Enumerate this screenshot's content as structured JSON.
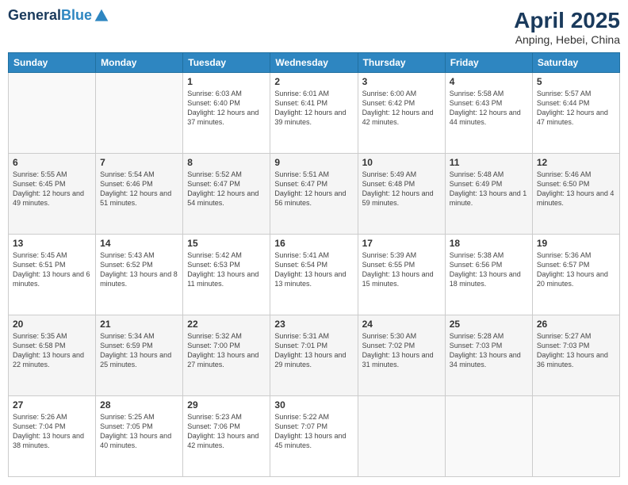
{
  "header": {
    "logo_line1": "General",
    "logo_line2": "Blue",
    "title": "April 2025",
    "subtitle": "Anping, Hebei, China"
  },
  "weekdays": [
    "Sunday",
    "Monday",
    "Tuesday",
    "Wednesday",
    "Thursday",
    "Friday",
    "Saturday"
  ],
  "weeks": [
    [
      {
        "day": "",
        "info": ""
      },
      {
        "day": "",
        "info": ""
      },
      {
        "day": "1",
        "info": "Sunrise: 6:03 AM\nSunset: 6:40 PM\nDaylight: 12 hours and 37 minutes."
      },
      {
        "day": "2",
        "info": "Sunrise: 6:01 AM\nSunset: 6:41 PM\nDaylight: 12 hours and 39 minutes."
      },
      {
        "day": "3",
        "info": "Sunrise: 6:00 AM\nSunset: 6:42 PM\nDaylight: 12 hours and 42 minutes."
      },
      {
        "day": "4",
        "info": "Sunrise: 5:58 AM\nSunset: 6:43 PM\nDaylight: 12 hours and 44 minutes."
      },
      {
        "day": "5",
        "info": "Sunrise: 5:57 AM\nSunset: 6:44 PM\nDaylight: 12 hours and 47 minutes."
      }
    ],
    [
      {
        "day": "6",
        "info": "Sunrise: 5:55 AM\nSunset: 6:45 PM\nDaylight: 12 hours and 49 minutes."
      },
      {
        "day": "7",
        "info": "Sunrise: 5:54 AM\nSunset: 6:46 PM\nDaylight: 12 hours and 51 minutes."
      },
      {
        "day": "8",
        "info": "Sunrise: 5:52 AM\nSunset: 6:47 PM\nDaylight: 12 hours and 54 minutes."
      },
      {
        "day": "9",
        "info": "Sunrise: 5:51 AM\nSunset: 6:47 PM\nDaylight: 12 hours and 56 minutes."
      },
      {
        "day": "10",
        "info": "Sunrise: 5:49 AM\nSunset: 6:48 PM\nDaylight: 12 hours and 59 minutes."
      },
      {
        "day": "11",
        "info": "Sunrise: 5:48 AM\nSunset: 6:49 PM\nDaylight: 13 hours and 1 minute."
      },
      {
        "day": "12",
        "info": "Sunrise: 5:46 AM\nSunset: 6:50 PM\nDaylight: 13 hours and 4 minutes."
      }
    ],
    [
      {
        "day": "13",
        "info": "Sunrise: 5:45 AM\nSunset: 6:51 PM\nDaylight: 13 hours and 6 minutes."
      },
      {
        "day": "14",
        "info": "Sunrise: 5:43 AM\nSunset: 6:52 PM\nDaylight: 13 hours and 8 minutes."
      },
      {
        "day": "15",
        "info": "Sunrise: 5:42 AM\nSunset: 6:53 PM\nDaylight: 13 hours and 11 minutes."
      },
      {
        "day": "16",
        "info": "Sunrise: 5:41 AM\nSunset: 6:54 PM\nDaylight: 13 hours and 13 minutes."
      },
      {
        "day": "17",
        "info": "Sunrise: 5:39 AM\nSunset: 6:55 PM\nDaylight: 13 hours and 15 minutes."
      },
      {
        "day": "18",
        "info": "Sunrise: 5:38 AM\nSunset: 6:56 PM\nDaylight: 13 hours and 18 minutes."
      },
      {
        "day": "19",
        "info": "Sunrise: 5:36 AM\nSunset: 6:57 PM\nDaylight: 13 hours and 20 minutes."
      }
    ],
    [
      {
        "day": "20",
        "info": "Sunrise: 5:35 AM\nSunset: 6:58 PM\nDaylight: 13 hours and 22 minutes."
      },
      {
        "day": "21",
        "info": "Sunrise: 5:34 AM\nSunset: 6:59 PM\nDaylight: 13 hours and 25 minutes."
      },
      {
        "day": "22",
        "info": "Sunrise: 5:32 AM\nSunset: 7:00 PM\nDaylight: 13 hours and 27 minutes."
      },
      {
        "day": "23",
        "info": "Sunrise: 5:31 AM\nSunset: 7:01 PM\nDaylight: 13 hours and 29 minutes."
      },
      {
        "day": "24",
        "info": "Sunrise: 5:30 AM\nSunset: 7:02 PM\nDaylight: 13 hours and 31 minutes."
      },
      {
        "day": "25",
        "info": "Sunrise: 5:28 AM\nSunset: 7:03 PM\nDaylight: 13 hours and 34 minutes."
      },
      {
        "day": "26",
        "info": "Sunrise: 5:27 AM\nSunset: 7:03 PM\nDaylight: 13 hours and 36 minutes."
      }
    ],
    [
      {
        "day": "27",
        "info": "Sunrise: 5:26 AM\nSunset: 7:04 PM\nDaylight: 13 hours and 38 minutes."
      },
      {
        "day": "28",
        "info": "Sunrise: 5:25 AM\nSunset: 7:05 PM\nDaylight: 13 hours and 40 minutes."
      },
      {
        "day": "29",
        "info": "Sunrise: 5:23 AM\nSunset: 7:06 PM\nDaylight: 13 hours and 42 minutes."
      },
      {
        "day": "30",
        "info": "Sunrise: 5:22 AM\nSunset: 7:07 PM\nDaylight: 13 hours and 45 minutes."
      },
      {
        "day": "",
        "info": ""
      },
      {
        "day": "",
        "info": ""
      },
      {
        "day": "",
        "info": ""
      }
    ]
  ]
}
